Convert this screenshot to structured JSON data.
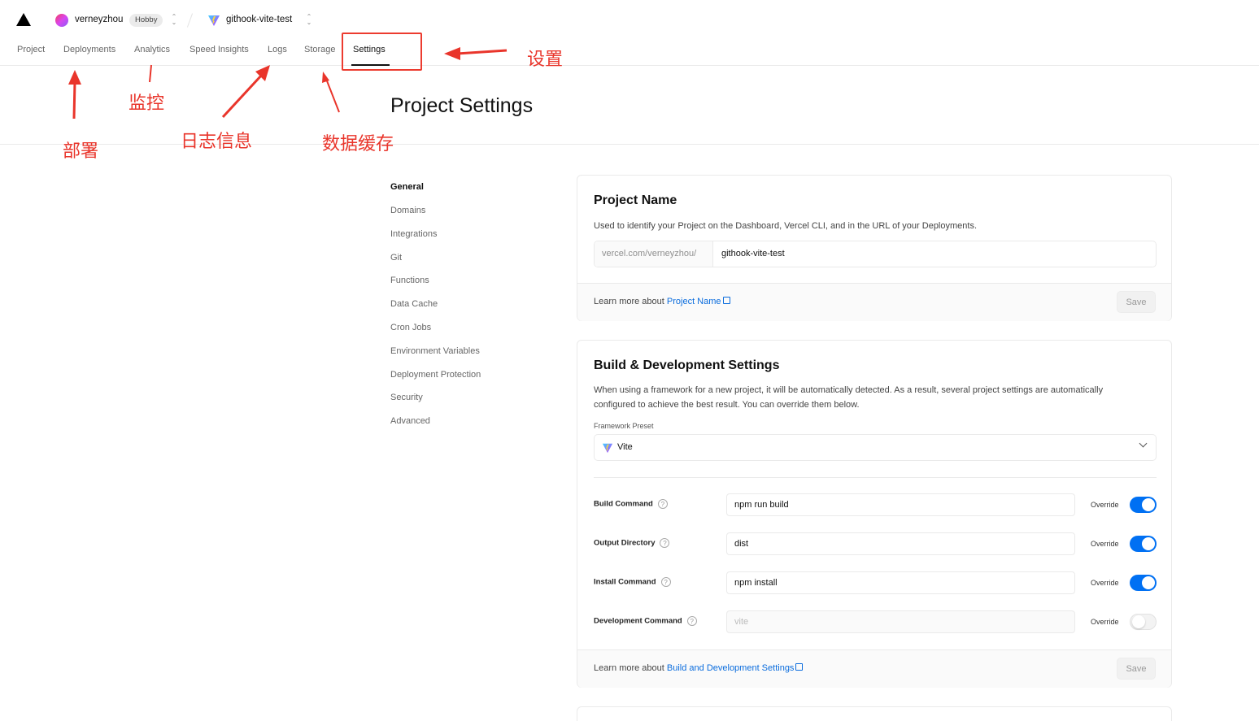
{
  "topbar": {
    "user": "verneyzhou",
    "plan": "Hobby",
    "project": "githook-vite-test"
  },
  "nav": {
    "tabs": [
      "Project",
      "Deployments",
      "Analytics",
      "Speed Insights",
      "Logs",
      "Storage",
      "Settings"
    ],
    "active": "Settings"
  },
  "page": {
    "title": "Project Settings"
  },
  "sidebar": {
    "items": [
      "General",
      "Domains",
      "Integrations",
      "Git",
      "Functions",
      "Data Cache",
      "Cron Jobs",
      "Environment Variables",
      "Deployment Protection",
      "Security",
      "Advanced"
    ],
    "active": "General"
  },
  "project_name_card": {
    "title": "Project Name",
    "description": "Used to identify your Project on the Dashboard, Vercel CLI, and in the URL of your Deployments.",
    "prefix": "vercel.com/verneyzhou/",
    "value": "githook-vite-test",
    "footer_text": "Learn more about ",
    "footer_link": "Project Name",
    "save_label": "Save"
  },
  "build_card": {
    "title": "Build & Development Settings",
    "description_1": "When using a framework for a new project, it will be automatically detected. As a result, several project settings are automatically",
    "description_2": "configured to achieve the best result. You can override them below.",
    "framework_label": "Framework Preset",
    "framework_value": "Vite",
    "rows": [
      {
        "label": "Build Command",
        "value": "npm run build",
        "override": true
      },
      {
        "label": "Output Directory",
        "value": "dist",
        "override": true
      },
      {
        "label": "Install Command",
        "value": "npm install",
        "override": true
      },
      {
        "label": "Development Command",
        "value": "vite",
        "override": false
      }
    ],
    "override_label": "Override",
    "help_glyph": "?",
    "footer_text": "Learn more about ",
    "footer_link": "Build and Development Settings",
    "save_label": "Save"
  },
  "annotations": {
    "settings": "设置",
    "deployments": "部署",
    "analytics": "监控",
    "logs": "日志信息",
    "storage": "数据缓存"
  },
  "colors": {
    "accent": "#0070f3",
    "link": "#0a6cdd",
    "annotation": "#e9352b"
  }
}
